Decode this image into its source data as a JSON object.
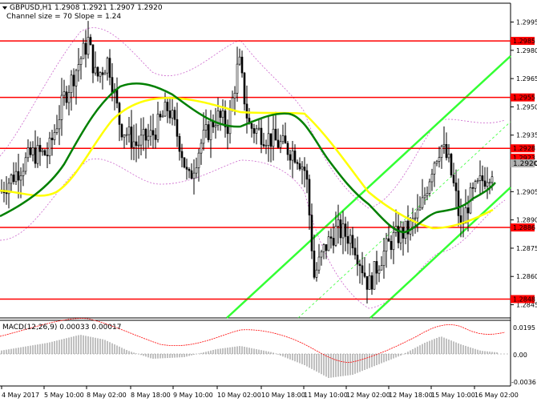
{
  "header": {
    "symbol_line": "GBPUSD,H1  1.2908 1.2921 1.2907 1.2920",
    "channel_line": "Channel size = 70 Slope = 1.24"
  },
  "colors": {
    "background": "#ffffff",
    "level": "#ff0000",
    "current_price": "#b0b0b0",
    "ma_fast": "#008000",
    "ma_slow": "#ffff00",
    "channel": "#33ff33",
    "bands": "#cc66cc",
    "candles": "#000000",
    "macd_hist": "#c0c0c0",
    "macd_signal": "#ff0000"
  },
  "price_axis": {
    "min": 1.2838,
    "max": 1.3005,
    "ticks": [
      "1.2995",
      "1.2980",
      "1.2965",
      "1.2950",
      "1.2935",
      "1.2920",
      "1.2905",
      "1.2890",
      "1.2875",
      "1.2860",
      "1.2845"
    ],
    "current_price": "1.2920"
  },
  "levels": [
    {
      "price": "1.2985",
      "value": 1.2985
    },
    {
      "price": "1.2955",
      "value": 1.2955
    },
    {
      "price": "1.2928",
      "value": 1.2928
    },
    {
      "price": "1.2923",
      "value": 1.2923
    },
    {
      "price": "1.2886",
      "value": 1.2886
    },
    {
      "price": "1.2848",
      "value": 1.2848
    }
  ],
  "macd": {
    "label": "MACD(12,26,9) 0.00033 0.00017",
    "ticks": [
      "0.0195",
      "0.00",
      "-0.0036"
    ]
  },
  "time_axis": {
    "labels": [
      "4 May 2017",
      "5 May 10:00",
      "8 May 02:00",
      "8 May 18:00",
      "9 May 10:00",
      "10 May 02:00",
      "10 May 18:00",
      "11 May 10:00",
      "12 May 02:00",
      "12 May 18:00",
      "15 May 10:00",
      "16 May 02:00"
    ]
  },
  "chart_data": {
    "type": "line",
    "title": "GBPUSD,H1",
    "x": [
      "4 May 2017",
      "5 May 10:00",
      "8 May 02:00",
      "8 May 18:00",
      "9 May 10:00",
      "10 May 02:00",
      "10 May 18:00",
      "11 May 10:00",
      "12 May 02:00",
      "12 May 18:00",
      "15 May 10:00",
      "16 May 02:00"
    ],
    "series": [
      {
        "name": "GBPUSD,H1",
        "values": [
          1.291,
          1.2955,
          1.2975,
          1.2925,
          1.2935,
          1.295,
          1.2925,
          1.2855,
          1.285,
          1.2885,
          1.293,
          1.292
        ]
      }
    ],
    "ylim": [
      1.2838,
      1.3005
    ]
  }
}
